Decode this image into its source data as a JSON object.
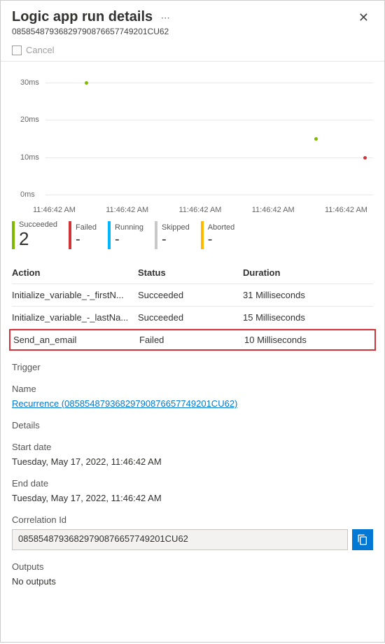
{
  "header": {
    "title": "Logic app run details",
    "subtitle": "08585487936829790876657749201CU62"
  },
  "toolbar": {
    "cancel": "Cancel"
  },
  "chart_data": {
    "type": "scatter",
    "ylabel_unit": "ms",
    "yticks": [
      "0ms",
      "10ms",
      "20ms",
      "30ms"
    ],
    "xticks": [
      "11:46:42 AM",
      "11:46:42 AM",
      "11:46:42 AM",
      "11:46:42 AM",
      "11:46:42 AM"
    ],
    "points": [
      {
        "x_pct": 12,
        "y_ms": 31,
        "color": "#7fba00"
      },
      {
        "x_pct": 82,
        "y_ms": 15,
        "color": "#7fba00"
      },
      {
        "x_pct": 97,
        "y_ms": 10,
        "color": "#d13438"
      }
    ],
    "ylim": [
      0,
      30
    ]
  },
  "statuses": [
    {
      "label": "Succeeded",
      "value": "2",
      "color": "#7fba00"
    },
    {
      "label": "Failed",
      "value": "-",
      "color": "#d13438"
    },
    {
      "label": "Running",
      "value": "-",
      "color": "#00b7ff"
    },
    {
      "label": "Skipped",
      "value": "-",
      "color": "#c8c8c8"
    },
    {
      "label": "Aborted",
      "value": "-",
      "color": "#ffb900"
    }
  ],
  "table": {
    "head": {
      "action": "Action",
      "status": "Status",
      "duration": "Duration"
    },
    "rows": [
      {
        "action": "Initialize_variable_-_firstN...",
        "status": "Succeeded",
        "duration": "31 Milliseconds",
        "failed": false
      },
      {
        "action": "Initialize_variable_-_lastNa...",
        "status": "Succeeded",
        "duration": "15 Milliseconds",
        "failed": false
      },
      {
        "action": "Send_an_email",
        "status": "Failed",
        "duration": "10 Milliseconds",
        "failed": true
      }
    ]
  },
  "trigger": {
    "section": "Trigger",
    "name_label": "Name",
    "link": "Recurrence (08585487936829790876657749201CU62)"
  },
  "details": {
    "section": "Details",
    "start_label": "Start date",
    "start_value": "Tuesday, May 17, 2022, 11:46:42 AM",
    "end_label": "End date",
    "end_value": "Tuesday, May 17, 2022, 11:46:42 AM",
    "corr_label": "Correlation Id",
    "corr_value": "08585487936829790876657749201CU62"
  },
  "outputs": {
    "section": "Outputs",
    "value": "No outputs"
  }
}
